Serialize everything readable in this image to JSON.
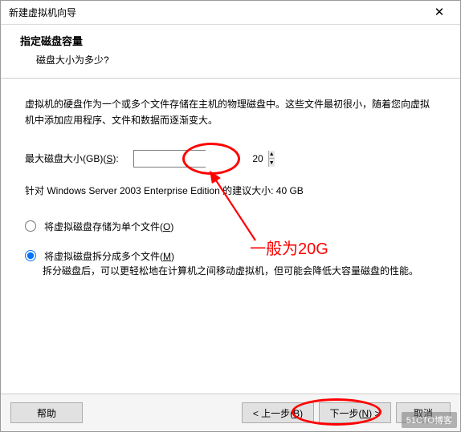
{
  "window": {
    "title": "新建虚拟机向导",
    "close_glyph": "✕"
  },
  "header": {
    "heading": "指定磁盘容量",
    "sub": "磁盘大小为多少?"
  },
  "content": {
    "intro": "虚拟机的硬盘作为一个或多个文件存储在主机的物理磁盘中。这些文件最初很小，随着您向虚拟机中添加应用程序、文件和数据而逐渐变大。",
    "size_label_prefix": "最大磁盘大小(GB)(",
    "size_label_key": "S",
    "size_label_suffix": "):",
    "size_value": "20",
    "recommended": "针对 Windows Server 2003 Enterprise Edition 的建议大小: 40 GB",
    "radio1_prefix": "将虚拟磁盘存储为单个文件(",
    "radio1_key": "O",
    "radio1_suffix": ")",
    "radio2_prefix": "将虚拟磁盘拆分成多个文件(",
    "radio2_key": "M",
    "radio2_suffix": ")",
    "radio2_desc": "拆分磁盘后，可以更轻松地在计算机之间移动虚拟机，但可能会降低大容量磁盘的性能。",
    "selected": "split"
  },
  "footer": {
    "help": "帮助",
    "back_prefix": "< 上一步(",
    "back_key": "B",
    "back_suffix": ")",
    "next_prefix": "下一步(",
    "next_key": "N",
    "next_suffix": ") >",
    "cancel": "取消"
  },
  "annotation": {
    "note": "一般为20G"
  },
  "watermark": "51CTO博客"
}
